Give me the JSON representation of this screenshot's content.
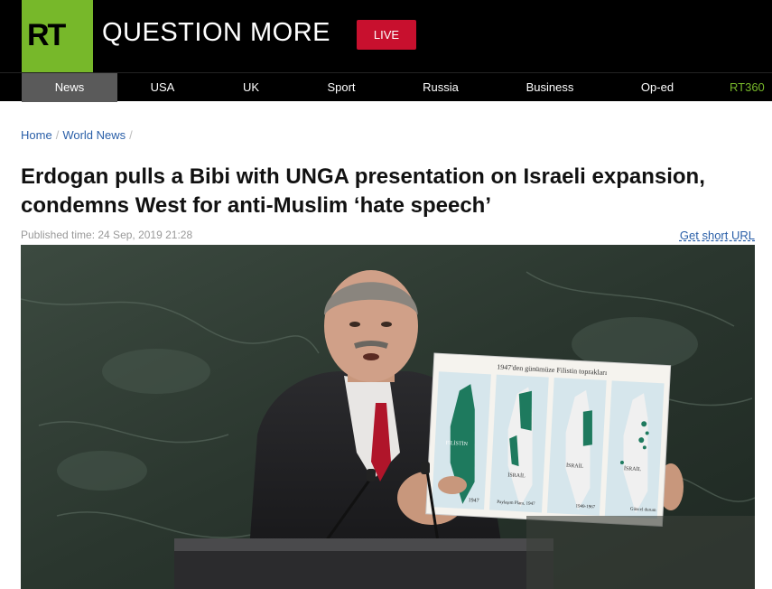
{
  "header": {
    "logo_text": "RT",
    "tagline": "QUESTION MORE",
    "live_label": "LIVE"
  },
  "nav": {
    "items": [
      {
        "label": "News"
      },
      {
        "label": "USA"
      },
      {
        "label": "UK"
      },
      {
        "label": "Sport"
      },
      {
        "label": "Russia"
      },
      {
        "label": "Business"
      },
      {
        "label": "Op-ed"
      },
      {
        "label": "RT360"
      }
    ]
  },
  "breadcrumb": {
    "home": "Home",
    "section": "World News"
  },
  "article": {
    "headline": "Erdogan pulls a Bibi with UNGA presentation on Israeli expansion, condemns West for anti-Muslim ‘hate speech’",
    "published": "Published time: 24 Sep, 2019 21:28",
    "short_url_label": "Get short URL"
  },
  "photo": {
    "map_title": "1947'den günümüze Filistin toprakları",
    "panels": [
      {
        "region_label": "FİLİSTİN",
        "caption": "1947"
      },
      {
        "region_label": "İSRAİL",
        "caption": "Paylaşım Planı, 1947"
      },
      {
        "region_label": "İSRAİL",
        "caption": "1949-1967"
      },
      {
        "region_label": "İSRAİL",
        "caption": "Güncel durum"
      }
    ]
  },
  "colors": {
    "brand_green": "#77b82a",
    "live_red": "#c8102e",
    "link_blue": "#2a5fa8"
  }
}
